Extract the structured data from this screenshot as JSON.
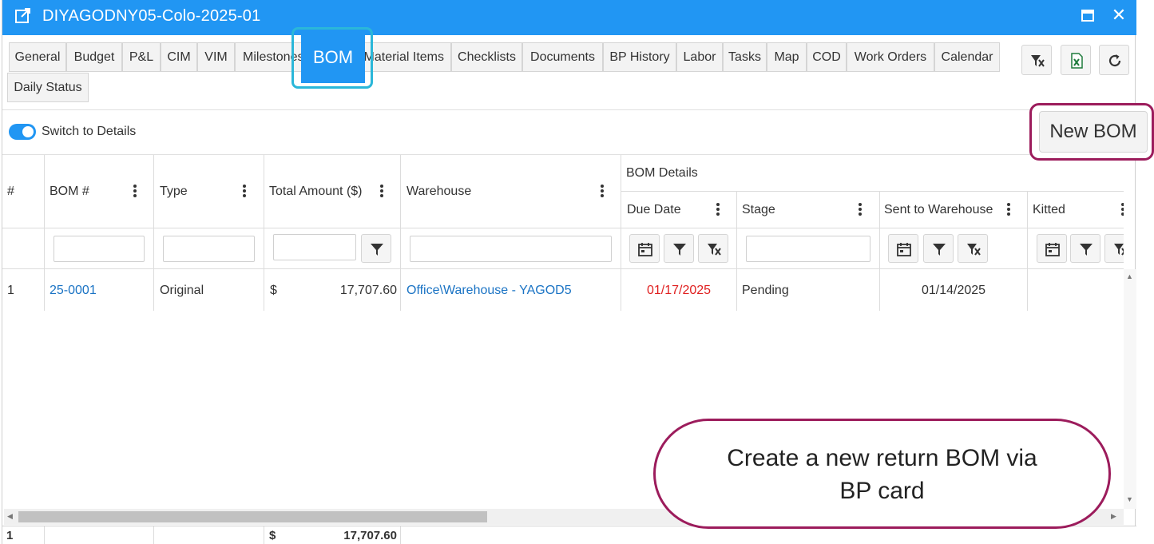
{
  "window": {
    "title": "DIYAGODNY05-Colo-2025-01"
  },
  "tabs": [
    {
      "label": "General"
    },
    {
      "label": "Budget"
    },
    {
      "label": "P&L"
    },
    {
      "label": "CIM"
    },
    {
      "label": "VIM"
    },
    {
      "label": "Milestones"
    },
    {
      "label": "BOM",
      "active": true
    },
    {
      "label": "Material Items"
    },
    {
      "label": "Checklists"
    },
    {
      "label": "Documents"
    },
    {
      "label": "BP History"
    },
    {
      "label": "Labor"
    },
    {
      "label": "Tasks"
    },
    {
      "label": "Map"
    },
    {
      "label": "COD"
    },
    {
      "label": "Work Orders"
    },
    {
      "label": "Calendar"
    },
    {
      "label": "Daily Status"
    }
  ],
  "toolbar": {
    "toggle_label": "Switch to Details",
    "toggle_on": true,
    "new_bom_label": "New BOM"
  },
  "grid": {
    "columns": {
      "row_num": "#",
      "bom_num": "BOM #",
      "type": "Type",
      "total_amount": "Total Amount ($)",
      "warehouse": "Warehouse",
      "group_bom_details": "BOM Details",
      "due_date": "Due Date",
      "stage": "Stage",
      "sent_to_warehouse": "Sent to Warehouse",
      "kitted": "Kitted"
    },
    "rows": [
      {
        "row_num": "1",
        "bom_num": "25-0001",
        "type": "Original",
        "currency": "$",
        "total_amount": "17,707.60",
        "warehouse": "Office\\Warehouse - YAGOD5",
        "due_date": "01/17/2025",
        "stage": "Pending",
        "sent_to_warehouse": "01/14/2025",
        "kitted": ""
      }
    ],
    "footer": {
      "count": "1",
      "currency": "$",
      "total_amount": "17,707.60"
    }
  },
  "callout": {
    "line1": "Create a new return BOM via",
    "line2": "BP card"
  },
  "colors": {
    "accent": "#2196f3",
    "callout_border": "#9c1c5c",
    "highlight_ring": "#2ab7d9",
    "overdue": "#e02020",
    "link": "#1a73c4"
  }
}
